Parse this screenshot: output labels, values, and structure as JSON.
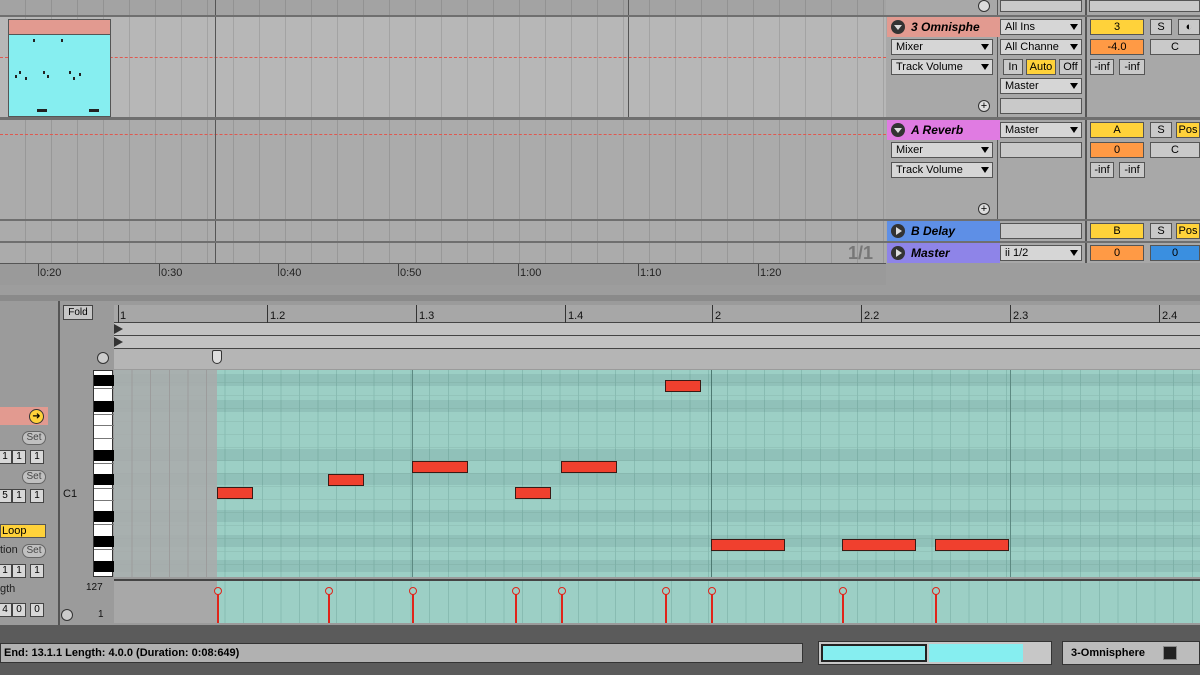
{
  "tracks": {
    "omnisphere": {
      "name": "3 Omnisphe",
      "color": "#e29a90",
      "mixer_select": "Mixer",
      "param_select": "Track Volume",
      "input_type": "All Ins",
      "input_channel": "All Channe",
      "monitor_in": "In",
      "monitor_auto": "Auto",
      "monitor_off": "Off",
      "output": "Master",
      "activator": "3",
      "solo": "S",
      "volume": "-4.0",
      "pan": "C",
      "send_a": "-inf",
      "send_b": "-inf"
    },
    "reverb": {
      "name": "A Reverb",
      "color": "#e07be2",
      "mixer_select": "Mixer",
      "param_select": "Track Volume",
      "output": "Master",
      "activator": "A",
      "solo": "S",
      "post": "Pos",
      "volume": "0",
      "pan": "C",
      "send_a": "-inf",
      "send_b": "-inf"
    },
    "delay": {
      "name": "B Delay",
      "color": "#5e8fe6",
      "activator": "B",
      "solo": "S",
      "post": "Pos"
    },
    "master": {
      "name": "Master",
      "color": "#8e84e8",
      "cue": "1/2",
      "cue_prefix": "ii",
      "volume": "0",
      "cue_volume": "0"
    }
  },
  "arrangement": {
    "zoom_ratio": "1/1",
    "time_labels": [
      "0:20",
      "0:30",
      "0:40",
      "0:50",
      "1:00",
      "1:10",
      "1:20"
    ]
  },
  "clip_view": {
    "fold_label": "Fold",
    "ruler_labels": [
      "1",
      "1.2",
      "1.3",
      "1.4",
      "2",
      "2.2",
      "2.3",
      "2.4"
    ],
    "key_label": "C1",
    "velocity_max": "127",
    "velocity_min": "1",
    "props": {
      "set1": "Set",
      "set2": "Set",
      "set3": "Set",
      "loop": "Loop",
      "label_position": "tion",
      "label_length": "gth",
      "row1": [
        "1",
        "1",
        "1"
      ],
      "row2": [
        "5",
        "1",
        "1"
      ],
      "row3": [
        "1",
        "1",
        "1"
      ],
      "row4": [
        "4",
        "0",
        "0"
      ]
    }
  },
  "status_bar": {
    "text": "End: 13.1.1    Length: 4.0.0  (Duration: 0:08:649)",
    "track_name": "3-Omnisphere"
  },
  "colors": {
    "note": "#f0402e",
    "grid": "#9ccfc5",
    "clip": "#86eef0",
    "activator": "#ffd23a",
    "volume": "#ff9a45"
  }
}
